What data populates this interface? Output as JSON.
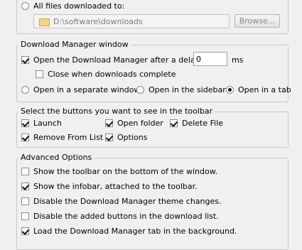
{
  "download_location": {
    "all_files_label": "All files downloaded to:",
    "path_value": "D:\\software\\downloads",
    "browse_label": "Browse..."
  },
  "dm_window": {
    "title": "Download Manager window",
    "open_after_delay_label": "Open the Download Manager after a delay of",
    "delay_value": "0",
    "delay_unit": "ms",
    "close_when_complete_label": "Close when downloads complete",
    "open_separate_label": "Open in a separate window",
    "open_sidebar_label": "Open in the sidebar",
    "open_tab_label": "Open in a tab"
  },
  "toolbar_buttons": {
    "title": "Select the buttons you want to see in the toolbar",
    "launch_label": "Launch",
    "open_folder_label": "Open folder",
    "delete_file_label": "Delete File",
    "remove_from_list_label": "Remove From List",
    "options_label": "Options"
  },
  "advanced": {
    "title": "Advanced Options",
    "items": [
      "Show the toolbar on the bottom of the window.",
      "Show the infobar, attached to the toolbar.",
      "Disable the Download Manager theme changes.",
      "Disable the added buttons in the download list.",
      "Load the Download Manager tab in the background."
    ]
  }
}
